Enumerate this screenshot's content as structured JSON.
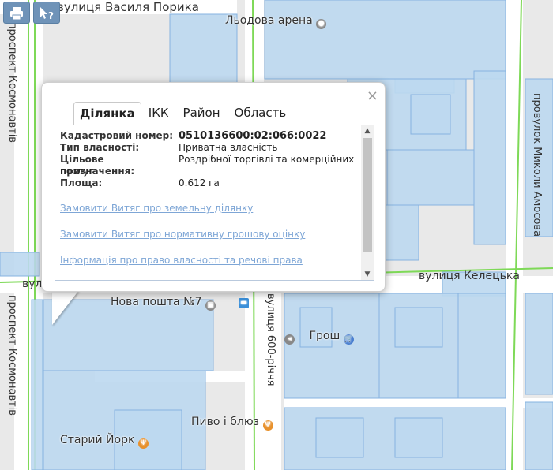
{
  "toolbar": {
    "print_icon": "printer-icon",
    "info_icon": "cursor-question-icon",
    "info_text": "?"
  },
  "map": {
    "streets": {
      "vasylia_poryka": "вулиця Василя Порика",
      "kosmonavtiv_top": "проспект Космонавтів",
      "kosmonavtiv_bottom": "проспект Космонавтів",
      "mykoly_amosova": "провулок Миколи Амосова",
      "keletska": "вулиця Келецька",
      "vul_partial": "вули",
      "600_richchia": "вулиця 600-річчя"
    },
    "pois": {
      "lodova_arena": "Льодова арена",
      "nova_poshta": "Нова пошта №7",
      "grosh": "Грош",
      "pyvo_i_blues": "Пиво і блюз",
      "staryi_york": "Старий Йорк"
    },
    "colors": {
      "background": "#e9e9e9",
      "parcel_fill": "#bcd8f0",
      "parcel_stroke": "#86b3e0",
      "road": "#ffffff",
      "green_line": "#7ed957"
    }
  },
  "popup": {
    "close_label": "×",
    "tabs": [
      {
        "label": "Ділянка",
        "active": true
      },
      {
        "label": "ІКК",
        "active": false
      },
      {
        "label": "Район",
        "active": false
      },
      {
        "label": "Область",
        "active": false
      }
    ],
    "fields": [
      {
        "key": "Кадастровий номер:",
        "value": "0510136600:02:066:0022"
      },
      {
        "key": "Тип власності:",
        "value": "Приватна власність"
      },
      {
        "key": "Цільове призначення:",
        "value": "Роздрібної торгівлі та комерційних послуг"
      },
      {
        "key": "Площа:",
        "value": "0.612 га"
      }
    ],
    "links": [
      "Замовити Витяг про земельну ділянку",
      "Замовити Витяг про нормативну грошову оцінку",
      "Інформація про право власності та речові права"
    ]
  }
}
